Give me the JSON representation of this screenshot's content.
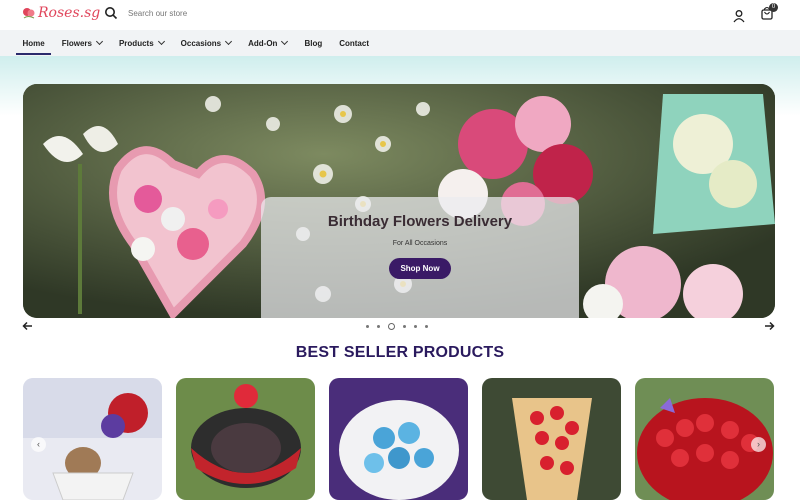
{
  "header": {
    "logo_text": "Roses.sg",
    "search_placeholder": "Search our store",
    "cart_count": "0"
  },
  "nav": {
    "items": [
      {
        "label": "Home",
        "dropdown": false,
        "active": true
      },
      {
        "label": "Flowers",
        "dropdown": true
      },
      {
        "label": "Products",
        "dropdown": true
      },
      {
        "label": "Occasions",
        "dropdown": true
      },
      {
        "label": "Add-On",
        "dropdown": true
      },
      {
        "label": "Blog",
        "dropdown": false
      },
      {
        "label": "Contact",
        "dropdown": false
      }
    ]
  },
  "hero": {
    "title": "Birthday Flowers Delivery",
    "subtitle": "For All Occasions",
    "button_label": "Shop Now",
    "slide_count": 6,
    "active_slide": 3
  },
  "best_sellers": {
    "title": "BEST SELLER PRODUCTS"
  },
  "colors": {
    "brand": "#e0455b",
    "accent": "#3a1a66",
    "heading": "#2a1a5e"
  }
}
